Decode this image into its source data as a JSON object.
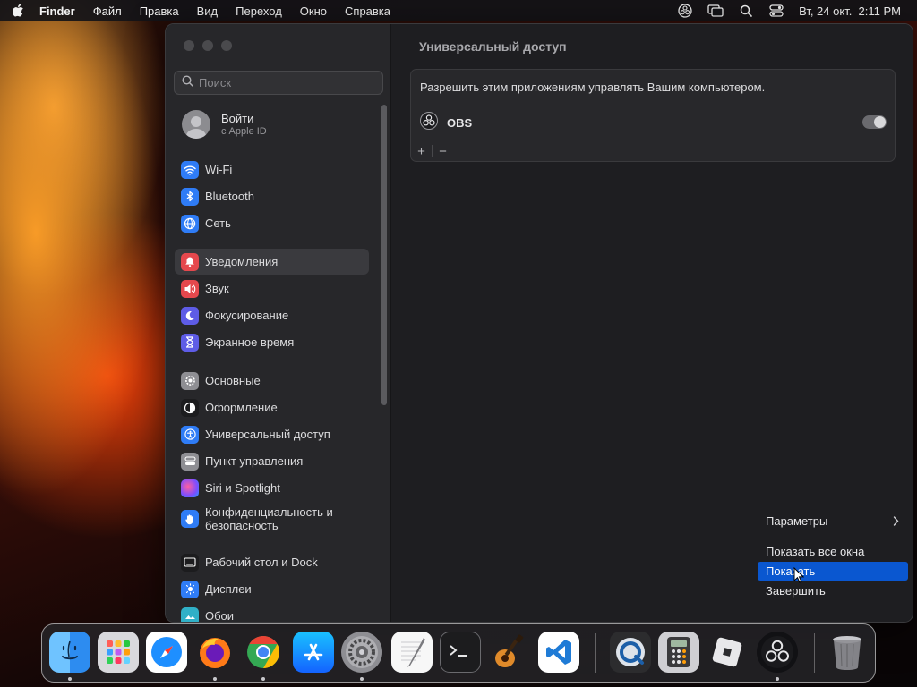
{
  "menubar": {
    "app_name": "Finder",
    "menus": [
      "Файл",
      "Правка",
      "Вид",
      "Переход",
      "Окно",
      "Справка"
    ],
    "clock": "Вт, 24 окт.  2:11 PM"
  },
  "window": {
    "search": {
      "placeholder": "Поиск",
      "value": ""
    },
    "account": {
      "title": "Войти",
      "subtitle": "с Apple ID"
    },
    "sidebar": {
      "items": [
        {
          "label": "Wi-Fi",
          "icon": "wifi-icon",
          "color": "#2f7cf6"
        },
        {
          "label": "Bluetooth",
          "icon": "bluetooth-icon",
          "color": "#2f7cf6"
        },
        {
          "label": "Сеть",
          "icon": "globe-icon",
          "color": "#2f7cf6"
        },
        {
          "label": "Уведомления",
          "icon": "bell-icon",
          "color": "#e5484d",
          "selected": true
        },
        {
          "label": "Звук",
          "icon": "speaker-icon",
          "color": "#e5484d"
        },
        {
          "label": "Фокусирование",
          "icon": "moon-icon",
          "color": "#5e5ce6"
        },
        {
          "label": "Экранное время",
          "icon": "hourglass-icon",
          "color": "#5e5ce6"
        },
        {
          "label": "Основные",
          "icon": "gear-icon",
          "color": "#8e8e93"
        },
        {
          "label": "Оформление",
          "icon": "appearance-icon",
          "color": "#1c1c1e"
        },
        {
          "label": "Универсальный доступ",
          "icon": "accessibility-icon",
          "color": "#2f7cf6"
        },
        {
          "label": "Пункт управления",
          "icon": "control-center-icon",
          "color": "#8e8e93"
        },
        {
          "label": "Siri и Spotlight",
          "icon": "siri-icon",
          "color": "#bf5af2"
        },
        {
          "label": "Конфиденциальность и безопасность",
          "icon": "hand-icon",
          "color": "#2f7cf6"
        },
        {
          "label": "Рабочий стол и Dock",
          "icon": "desktop-icon",
          "color": "#1c1c1e"
        },
        {
          "label": "Дисплеи",
          "icon": "sun-icon",
          "color": "#2f7cf6"
        },
        {
          "label": "Обои",
          "icon": "wallpaper-icon",
          "color": "#30b0c7"
        }
      ]
    },
    "content": {
      "title": "Универсальный доступ",
      "description": "Разрешить этим приложениям управлять Вашим компьютером.",
      "apps": [
        {
          "name": "OBS",
          "enabled": true
        }
      ],
      "add_label": "+",
      "remove_label": "−"
    }
  },
  "context_menu": {
    "items": [
      {
        "label": "Параметры",
        "submenu": true
      },
      {
        "label": "Показать все окна"
      },
      {
        "label": "Показать",
        "highlighted": true
      },
      {
        "label": "Завершить"
      }
    ]
  },
  "dock": {
    "apps": [
      {
        "name": "finder-icon",
        "running": true
      },
      {
        "name": "launchpad-icon",
        "running": false
      },
      {
        "name": "safari-icon",
        "running": false
      },
      {
        "name": "firefox-icon",
        "running": true
      },
      {
        "name": "chrome-icon",
        "running": true
      },
      {
        "name": "app-store-icon",
        "running": false
      },
      {
        "name": "system-settings-icon",
        "running": true
      },
      {
        "name": "textedit-icon",
        "running": false
      },
      {
        "name": "terminal-icon",
        "running": false
      },
      {
        "name": "garageband-icon",
        "running": false
      },
      {
        "name": "vscode-icon",
        "running": false
      },
      {
        "name": "quicktime-icon",
        "running": false
      },
      {
        "name": "calculator-icon",
        "running": false
      },
      {
        "name": "roblox-icon",
        "running": false
      },
      {
        "name": "obs-icon",
        "running": true
      },
      {
        "name": "trash-icon",
        "running": false
      }
    ]
  },
  "colors": {
    "accent": "#0a57d0",
    "sidebar_bg": "#27272a",
    "content_bg": "#1e1e21"
  }
}
